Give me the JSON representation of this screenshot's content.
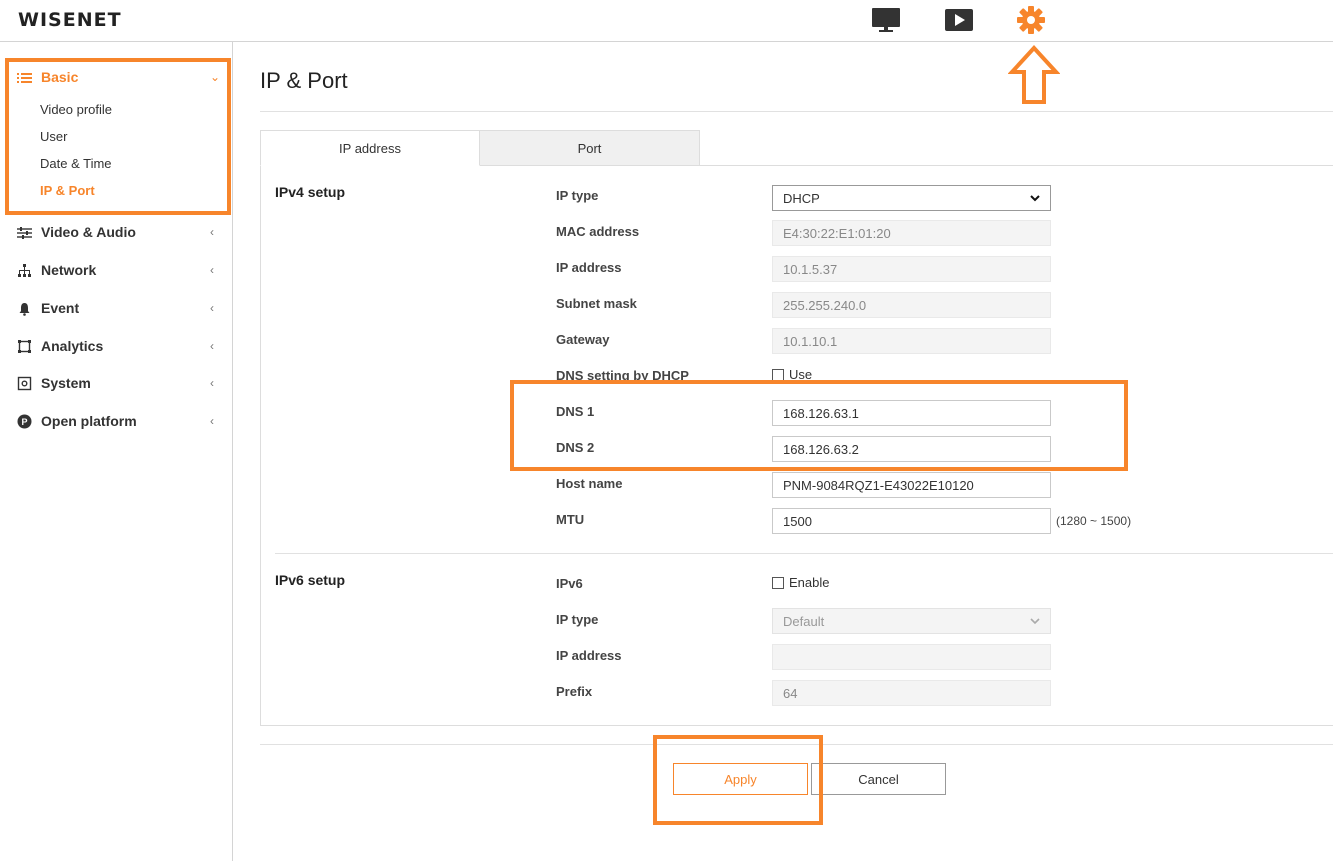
{
  "header": {
    "logo": "WISENET",
    "icons": [
      "monitor-icon",
      "play-icon",
      "gear-icon"
    ]
  },
  "sidebar": {
    "basic": {
      "label": "Basic",
      "items": [
        "Video profile",
        "User",
        "Date & Time",
        "IP & Port"
      ],
      "active": "IP & Port"
    },
    "groups": [
      {
        "label": "Video & Audio",
        "icon": "sliders-icon"
      },
      {
        "label": "Network",
        "icon": "network-icon"
      },
      {
        "label": "Event",
        "icon": "bell-icon"
      },
      {
        "label": "Analytics",
        "icon": "analytics-icon"
      },
      {
        "label": "System",
        "icon": "system-icon"
      },
      {
        "label": "Open platform",
        "icon": "platform-icon"
      }
    ]
  },
  "page": {
    "title": "IP & Port",
    "tabs": [
      "IP address",
      "Port"
    ],
    "active_tab": "IP address"
  },
  "ipv4": {
    "section_title": "IPv4 setup",
    "ip_type_label": "IP type",
    "ip_type_value": "DHCP",
    "mac_label": "MAC address",
    "mac_value": "E4:30:22:E1:01:20",
    "ip_label": "IP address",
    "ip_value": "10.1.5.37",
    "subnet_label": "Subnet mask",
    "subnet_value": "255.255.240.0",
    "gateway_label": "Gateway",
    "gateway_value": "10.1.10.1",
    "dns_dhcp_label": "DNS setting by DHCP",
    "dns_dhcp_option": "Use",
    "dns1_label": "DNS 1",
    "dns1_value": "168.126.63.1",
    "dns2_label": "DNS 2",
    "dns2_value": "168.126.63.2",
    "host_label": "Host name",
    "host_value": "PNM-9084RQZ1-E43022E10120",
    "mtu_label": "MTU",
    "mtu_value": "1500",
    "mtu_hint": "(1280 ~ 1500)"
  },
  "ipv6": {
    "section_title": "IPv6 setup",
    "ipv6_label": "IPv6",
    "ipv6_option": "Enable",
    "ip_type_label": "IP type",
    "ip_type_value": "Default",
    "ip_label": "IP address",
    "ip_value": "",
    "prefix_label": "Prefix",
    "prefix_value": "64"
  },
  "buttons": {
    "apply": "Apply",
    "cancel": "Cancel"
  },
  "colors": {
    "accent": "#f7852b",
    "highlight": "#f7852b"
  }
}
